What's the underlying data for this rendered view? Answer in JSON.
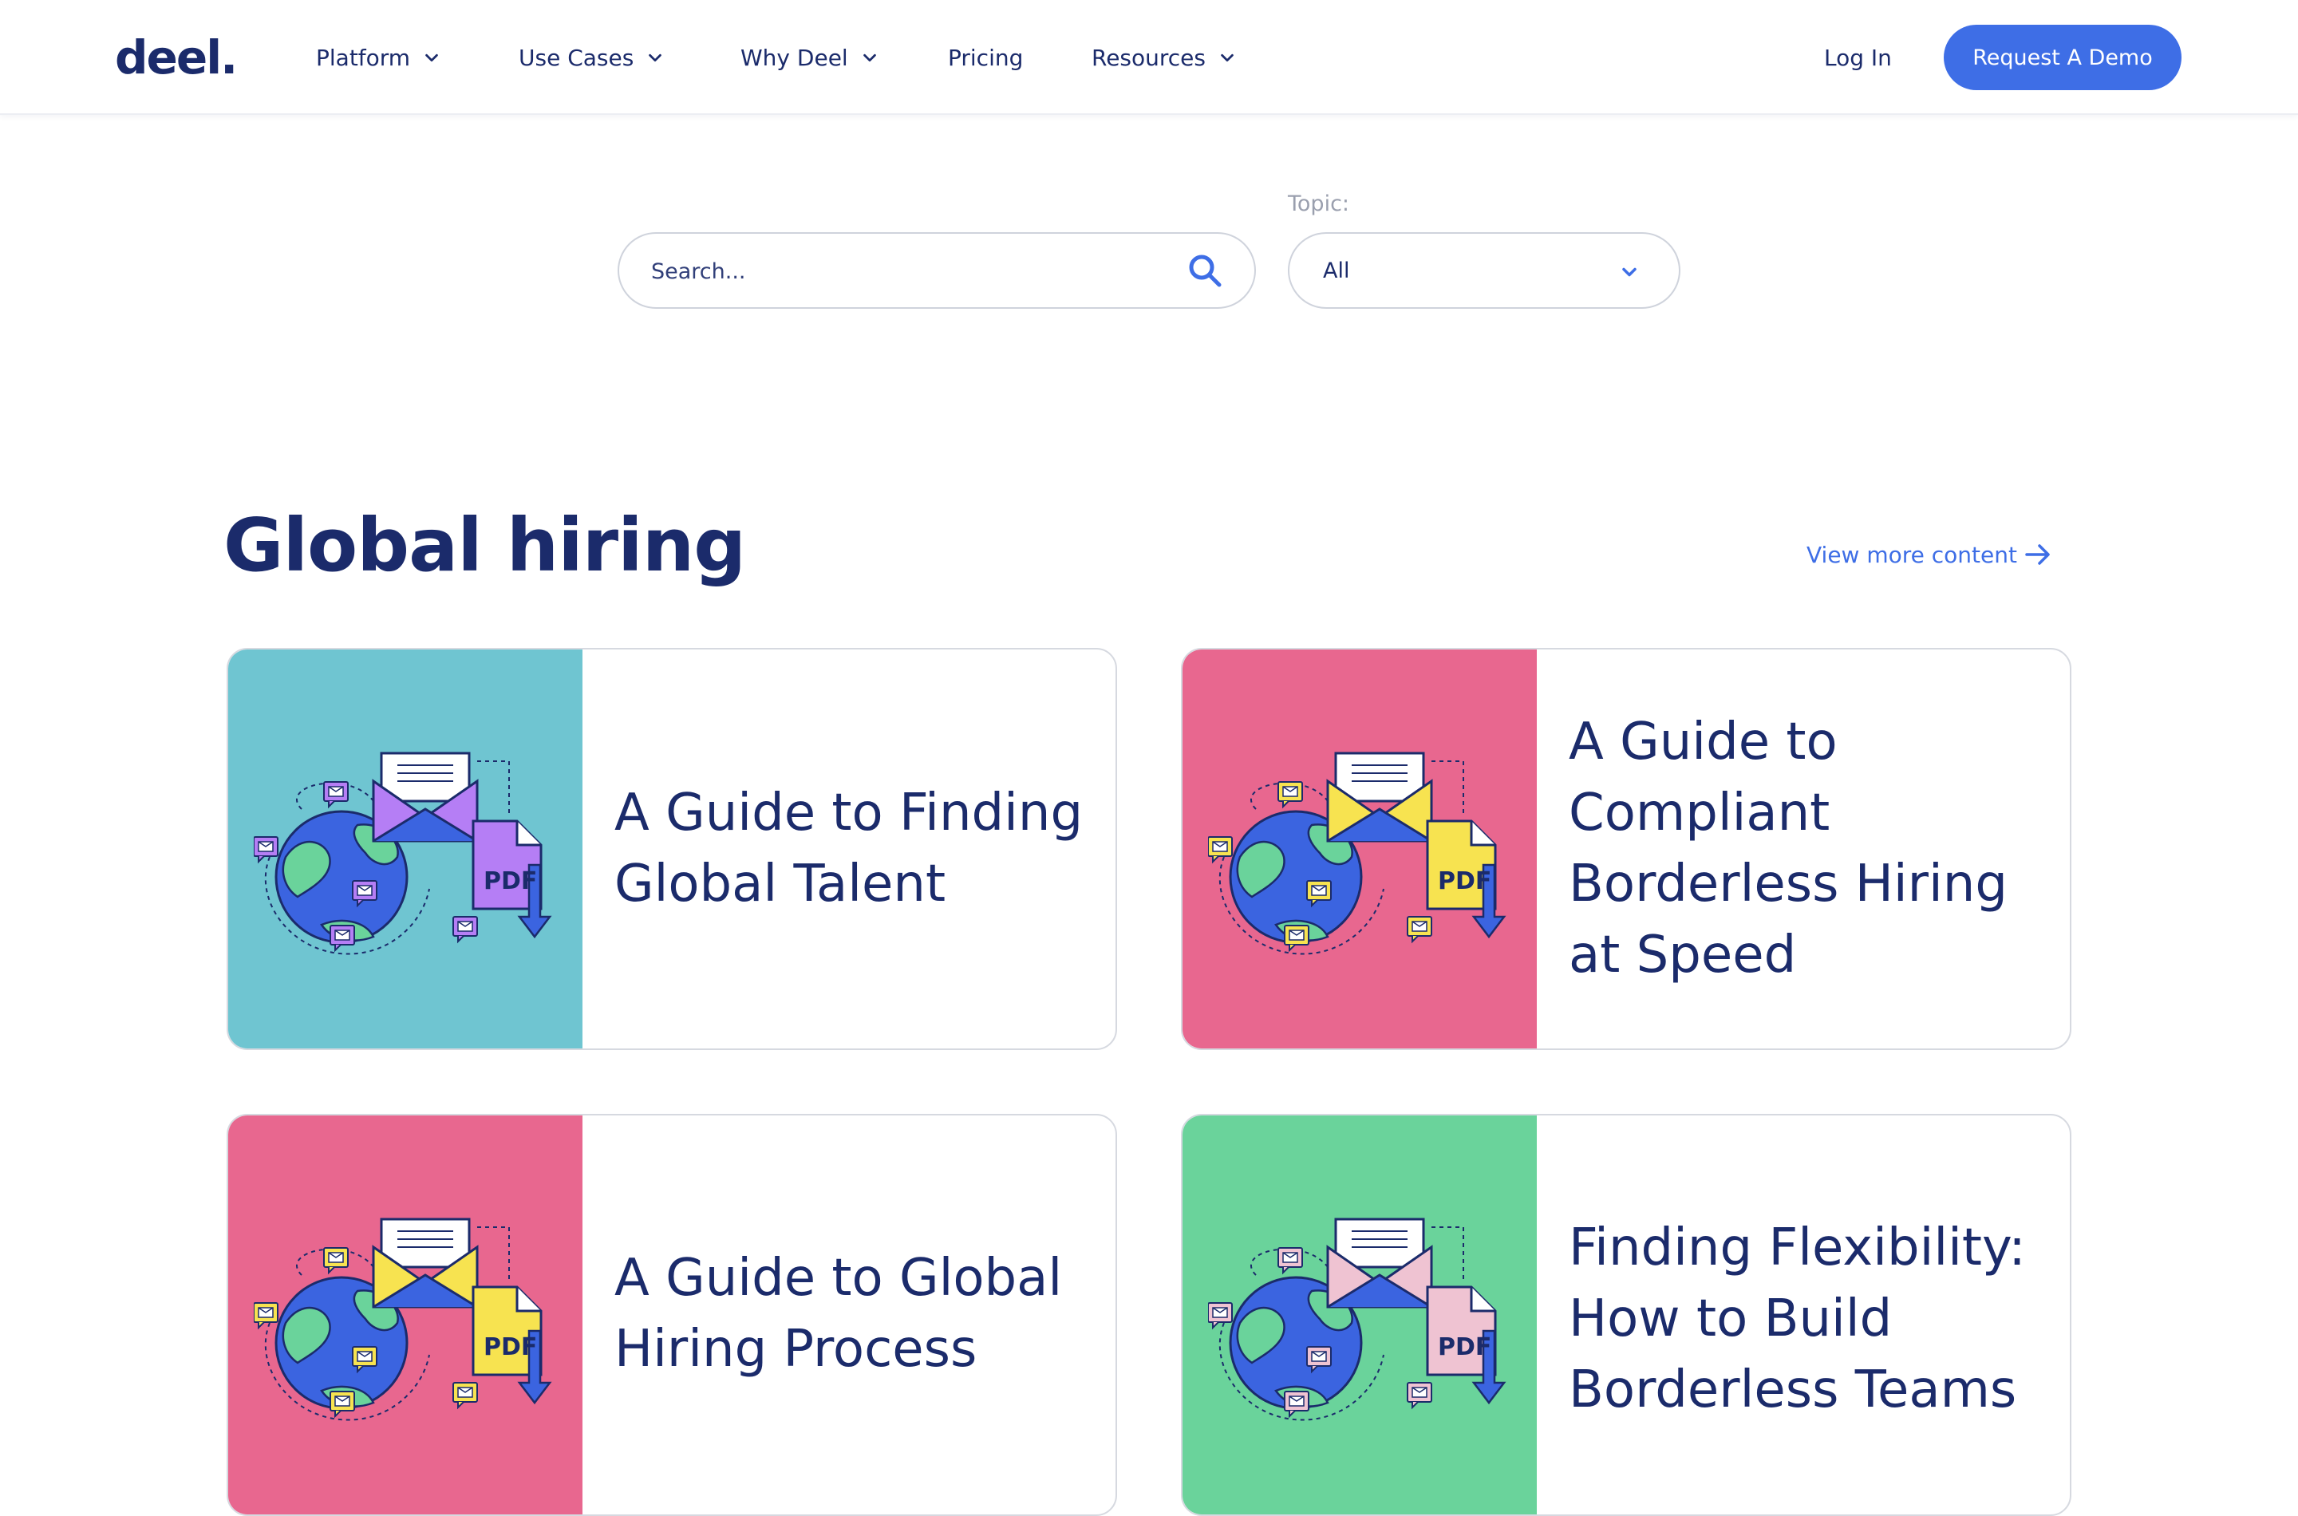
{
  "header": {
    "logo": "deel.",
    "nav": [
      {
        "label": "Platform",
        "has_dropdown": true
      },
      {
        "label": "Use Cases",
        "has_dropdown": true
      },
      {
        "label": "Why Deel",
        "has_dropdown": true
      },
      {
        "label": "Pricing",
        "has_dropdown": false
      },
      {
        "label": "Resources",
        "has_dropdown": true
      }
    ],
    "login_label": "Log In",
    "demo_label": "Request A Demo"
  },
  "filters": {
    "search_placeholder": "Search...",
    "topic_label": "Topic:",
    "topic_value": "All"
  },
  "section": {
    "title": "Global hiring",
    "view_more_label": "View more content"
  },
  "cards": [
    {
      "title": "A Guide to Finding Global Talent",
      "bg_color": "#6fc5d1",
      "accent_color": "#b57ef5",
      "icon": "globe-envelope-pdf-illustration"
    },
    {
      "title": "A Guide to Compliant Borderless Hiring at Speed",
      "bg_color": "#e8678f",
      "accent_color": "#f7e350",
      "icon": "globe-envelope-pdf-illustration"
    },
    {
      "title": "A Guide to Global Hiring Process",
      "bg_color": "#e8678f",
      "accent_color": "#f7e350",
      "icon": "globe-envelope-pdf-illustration"
    },
    {
      "title": "Finding Flexibility: How to Build Borderless Teams",
      "bg_color": "#6ad39b",
      "accent_color": "#efc3d2",
      "icon": "globe-envelope-pdf-illustration"
    }
  ],
  "pdf_label": "PDF",
  "colors": {
    "navy": "#1b2b6b",
    "accent_blue": "#3e6ee6",
    "globe_blue": "#3b64e0",
    "land_green": "#6ad39b"
  }
}
